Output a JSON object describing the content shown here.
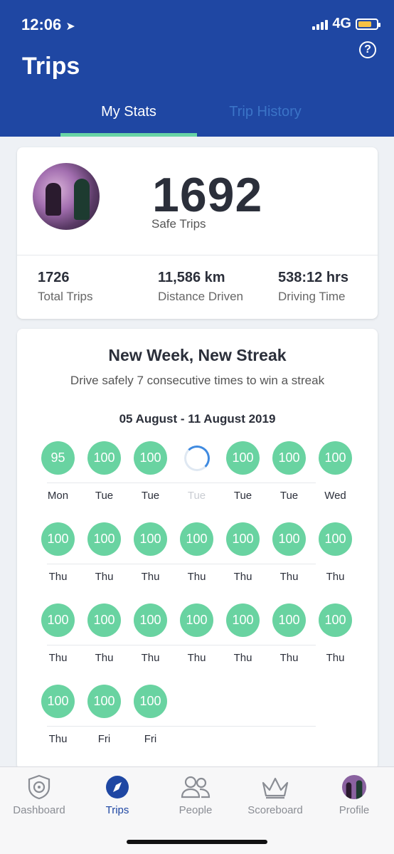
{
  "status_bar": {
    "time": "12:06",
    "network": "4G",
    "battery_color": "#f6c244"
  },
  "header": {
    "title": "Trips",
    "help_icon": "?",
    "tabs": [
      "My Stats",
      "Trip History"
    ],
    "active_tab": "My Stats",
    "bg_color": "#1f47a3",
    "accent_color": "#68d4a5"
  },
  "summary": {
    "safe_trips": "1692",
    "safe_trips_label": "Safe Trips",
    "stats": [
      {
        "value": "1726",
        "label": "Total Trips"
      },
      {
        "value": "11,586 km",
        "label": "Distance Driven"
      },
      {
        "value": "538:12 hrs",
        "label": "Driving Time"
      }
    ]
  },
  "streak": {
    "title": "New Week, New Streak",
    "subtitle": "Drive safely 7 consecutive times to win a streak",
    "range": "05 August - 11 August 2019",
    "score_color": "#69d3a1",
    "trips": [
      {
        "score": "95",
        "day": "Mon"
      },
      {
        "score": "100",
        "day": "Tue"
      },
      {
        "score": "100",
        "day": "Tue"
      },
      {
        "score": "",
        "day": "Tue",
        "pending": true
      },
      {
        "score": "100",
        "day": "Tue"
      },
      {
        "score": "100",
        "day": "Tue"
      },
      {
        "score": "100",
        "day": "Wed"
      },
      {
        "score": "100",
        "day": "Thu"
      },
      {
        "score": "100",
        "day": "Thu"
      },
      {
        "score": "100",
        "day": "Thu"
      },
      {
        "score": "100",
        "day": "Thu"
      },
      {
        "score": "100",
        "day": "Thu"
      },
      {
        "score": "100",
        "day": "Thu"
      },
      {
        "score": "100",
        "day": "Thu"
      },
      {
        "score": "100",
        "day": "Thu"
      },
      {
        "score": "100",
        "day": "Thu"
      },
      {
        "score": "100",
        "day": "Thu"
      },
      {
        "score": "100",
        "day": "Thu"
      },
      {
        "score": "100",
        "day": "Thu"
      },
      {
        "score": "100",
        "day": "Thu"
      },
      {
        "score": "100",
        "day": "Thu"
      },
      {
        "score": "100",
        "day": "Thu"
      },
      {
        "score": "100",
        "day": "Fri"
      },
      {
        "score": "100",
        "day": "Fri"
      }
    ]
  },
  "bottom_nav": [
    {
      "label": "Dashboard",
      "icon": "shield-steering-icon"
    },
    {
      "label": "Trips",
      "icon": "compass-icon",
      "active": true
    },
    {
      "label": "People",
      "icon": "people-icon"
    },
    {
      "label": "Scoreboard",
      "icon": "crown-icon"
    },
    {
      "label": "Profile",
      "icon": "avatar-icon"
    }
  ]
}
